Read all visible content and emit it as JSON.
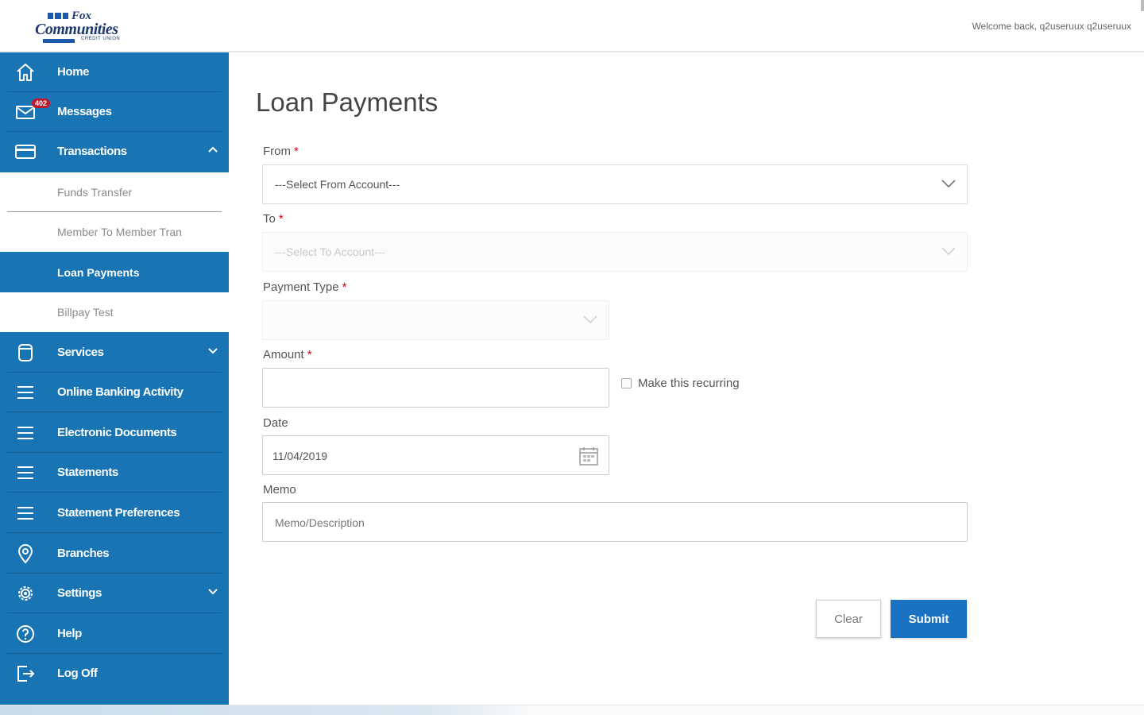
{
  "header": {
    "logo": {
      "line1": "Fox",
      "line2": "Communities",
      "line3": "CREDIT UNION"
    },
    "welcome": "Welcome back, q2useruux q2useruux"
  },
  "sidebar": {
    "items": [
      {
        "label": "Home",
        "icon": "home-icon"
      },
      {
        "label": "Messages",
        "icon": "mail-icon",
        "badge": "402"
      },
      {
        "label": "Transactions",
        "icon": "card-icon",
        "expanded": true
      },
      {
        "label": "Services",
        "icon": "cylinder-icon"
      },
      {
        "label": "Online Banking Activity",
        "icon": "menu-lines-icon"
      },
      {
        "label": "Electronic Documents",
        "icon": "menu-lines-icon"
      },
      {
        "label": "Statements",
        "icon": "menu-lines-icon"
      },
      {
        "label": "Statement Preferences",
        "icon": "menu-lines-icon"
      },
      {
        "label": "Branches",
        "icon": "location-pin-icon"
      },
      {
        "label": "Settings",
        "icon": "gear-icon"
      },
      {
        "label": "Help",
        "icon": "question-icon"
      },
      {
        "label": "Log Off",
        "icon": "logout-icon"
      }
    ],
    "subitems": [
      {
        "label": "Funds Transfer"
      },
      {
        "label": "Member To Member Tran"
      },
      {
        "label": "Loan Payments",
        "active": true
      },
      {
        "label": "Billpay Test"
      }
    ]
  },
  "main": {
    "title": "Loan Payments",
    "from": {
      "label": "From",
      "placeholder": "---Select From Account---"
    },
    "to": {
      "label": "To",
      "placeholder": "---Select To Account---"
    },
    "payment_type": {
      "label": "Payment Type",
      "value": ""
    },
    "amount": {
      "label": "Amount",
      "value": ""
    },
    "recurring": {
      "label": "Make this recurring",
      "checked": false
    },
    "date": {
      "label": "Date",
      "value": "11/04/2019"
    },
    "memo": {
      "label": "Memo",
      "placeholder": "Memo/Description"
    },
    "required_mark": "*",
    "buttons": {
      "clear": "Clear",
      "submit": "Submit"
    }
  },
  "colors": {
    "sidebar": "#1874b3",
    "submit": "#1a72c2",
    "required": "#d0021b",
    "badge": "#c0182b"
  }
}
